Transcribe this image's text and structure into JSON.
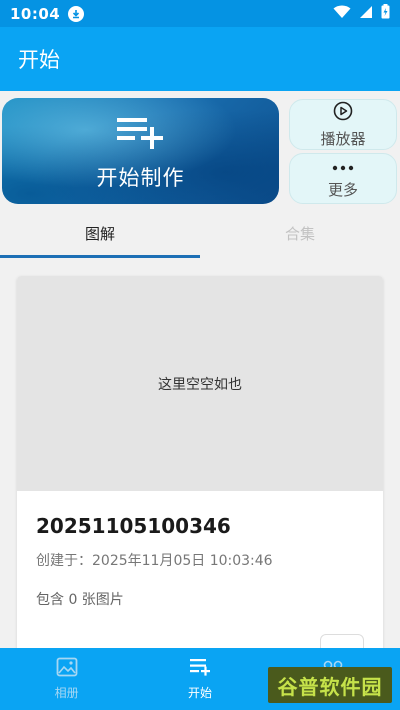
{
  "status_bar": {
    "time": "10:04",
    "icons": [
      "download-icon",
      "wifi-icon",
      "signal-icon",
      "battery-icon"
    ]
  },
  "app_bar": {
    "title": "开始"
  },
  "hero": {
    "label": "开始制作",
    "icon": "playlist-add-icon"
  },
  "side_buttons": [
    {
      "label": "播放器",
      "icon": "play-circle-icon"
    },
    {
      "label": "更多",
      "icon": "more-dots-icon"
    }
  ],
  "tabs": [
    {
      "label": "图解",
      "active": true
    },
    {
      "label": "合集",
      "active": false
    }
  ],
  "card": {
    "empty_text": "这里空空如也",
    "title": "20251105100346",
    "created": "创建于：2025年11月05日 10:03:46",
    "count": "包含 0 张图片"
  },
  "bottom_nav": [
    {
      "label": "相册",
      "icon": "album-icon",
      "active": false
    },
    {
      "label": "开始",
      "icon": "list-add-icon",
      "active": true
    },
    {
      "label": "",
      "icon": "grid-icon",
      "active": false
    }
  ],
  "watermark": {
    "text": "谷普软件园"
  },
  "colors": {
    "status_bar": "#0593e3",
    "app_bar": "#0aa4f3",
    "tab_indicator": "#1c6fb5",
    "side_button_bg": "#e3f6f8",
    "watermark_bg": "#4a5a1c",
    "watermark_text": "#c6e24a"
  }
}
